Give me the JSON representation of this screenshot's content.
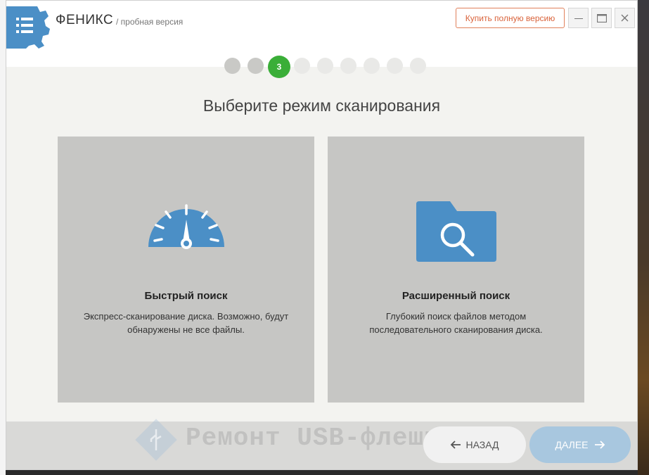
{
  "app": {
    "title": "ФЕНИКС",
    "subtitle": "/ пробная версия",
    "buy_label": "Купить полную версию",
    "window_controls": {
      "minimize": "minimize-icon",
      "maximize": "maximize-icon",
      "close": "close-icon"
    }
  },
  "wizard": {
    "total_steps": 9,
    "current_step_label": "3",
    "heading": "Выберите режим сканирования"
  },
  "options": {
    "fast": {
      "icon": "speedometer-icon",
      "title": "Быстрый поиск",
      "line1": "Экспресс-сканирование диска. Возможно, будут",
      "line2": "обнаружены не все файлы."
    },
    "advanced": {
      "icon": "folder-search-icon",
      "title": "Расширенный поиск",
      "line1": "Глубокий поиск файлов методом",
      "line2": "последовательного сканирования диска."
    }
  },
  "footer": {
    "watermark": "Ремонт USB-флешки",
    "back_label": "НАЗАД",
    "next_label": "ДАЛЕЕ"
  },
  "colors": {
    "accent_blue": "#4b8fc6",
    "step_current": "#3aae38",
    "buy_orange": "#d9623a",
    "next_disabled": "#a8c7df"
  }
}
